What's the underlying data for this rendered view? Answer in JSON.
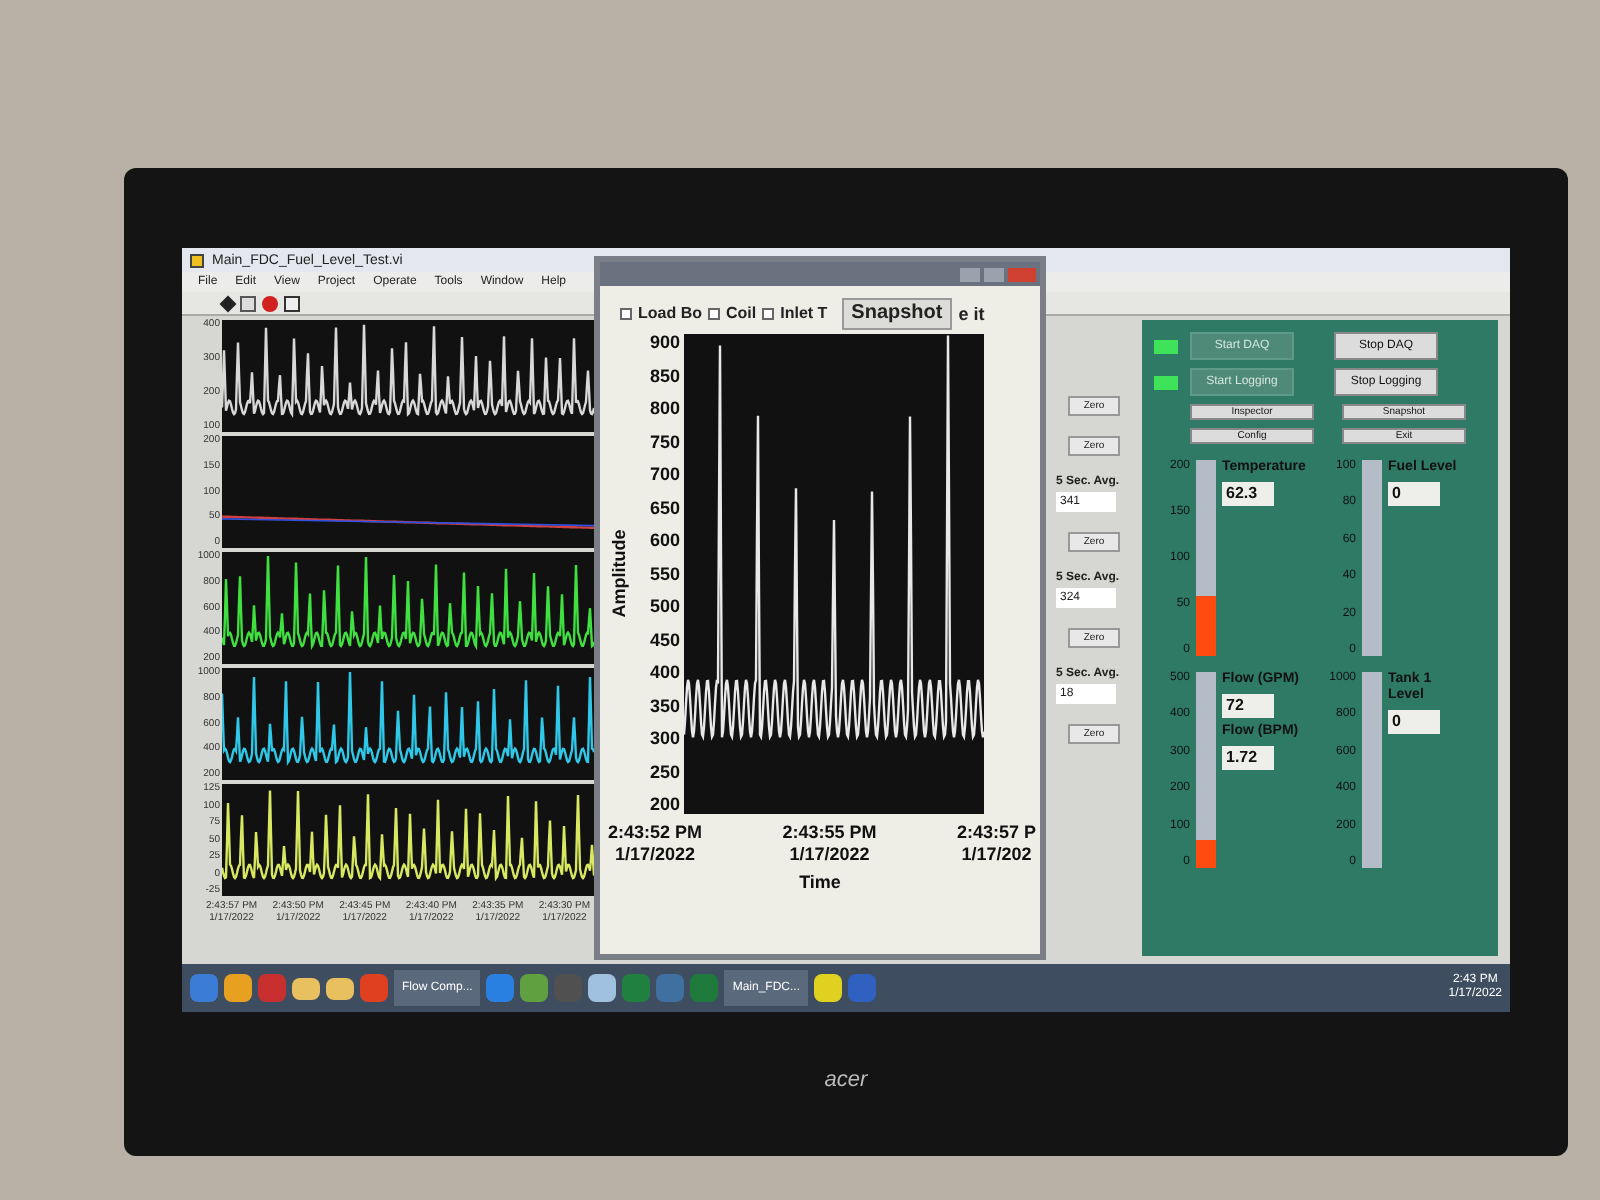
{
  "window": {
    "title": "Main_FDC_Fuel_Level_Test.vi",
    "menu": [
      "File",
      "Edit",
      "View",
      "Project",
      "Operate",
      "Tools",
      "Window",
      "Help"
    ]
  },
  "charts": [
    {
      "kind": "spikes",
      "color": "#d8d8d8",
      "y_ticks": [
        "400",
        "300",
        "200",
        "100"
      ]
    },
    {
      "kind": "flat",
      "color": "#d04040",
      "y_ticks": [
        "200",
        "150",
        "100",
        "50",
        "0"
      ]
    },
    {
      "kind": "spikes",
      "color": "#40e040",
      "y_ticks": [
        "1000",
        "800",
        "600",
        "400",
        "200"
      ]
    },
    {
      "kind": "spikes",
      "color": "#30c8e8",
      "y_ticks": [
        "1000",
        "800",
        "600",
        "400",
        "200"
      ]
    },
    {
      "kind": "spikes",
      "color": "#d8e860",
      "y_ticks": [
        "125",
        "100",
        "75",
        "50",
        "25",
        "0",
        "-25"
      ]
    }
  ],
  "x_labels": [
    {
      "time": "2:43:57 PM",
      "date": "1/17/2022"
    },
    {
      "time": "2:43:50 PM",
      "date": "1/17/2022"
    },
    {
      "time": "2:43:45 PM",
      "date": "1/17/2022"
    },
    {
      "time": "2:43:40 PM",
      "date": "1/17/2022"
    },
    {
      "time": "2:43:35 PM",
      "date": "1/17/2022"
    },
    {
      "time": "2:43:30 PM",
      "date": "1/17/2022"
    }
  ],
  "side_column": [
    {
      "kind": "button",
      "label": "Zero"
    },
    {
      "kind": "button",
      "label": "Zero"
    },
    {
      "kind": "average",
      "label": "5 Sec. Avg.",
      "value": "341"
    },
    {
      "kind": "button",
      "label": "Zero"
    },
    {
      "kind": "average",
      "label": "5 Sec. Avg.",
      "value": "324"
    },
    {
      "kind": "button",
      "label": "Zero"
    },
    {
      "kind": "average",
      "label": "5 Sec. Avg.",
      "value": "18"
    },
    {
      "kind": "button",
      "label": "Zero"
    }
  ],
  "popup": {
    "legend": [
      {
        "label": "Load Bo",
        "checked": false
      },
      {
        "label": "Coil",
        "checked": false
      },
      {
        "label": "Inlet T",
        "checked": false
      }
    ],
    "snapshot_button": "Snapshot",
    "cut_text": "e it",
    "y_ticks": [
      "900",
      "850",
      "800",
      "750",
      "700",
      "650",
      "600",
      "550",
      "500",
      "450",
      "400",
      "350",
      "300",
      "250",
      "200"
    ],
    "ylabel": "Amplitude",
    "x_labels": [
      {
        "time": "2:43:52 PM",
        "date": "1/17/2022"
      },
      {
        "time": "2:43:55 PM",
        "date": "1/17/2022"
      },
      {
        "time": "2:43:57 P",
        "date": "1/17/202"
      }
    ],
    "xlabel": "Time"
  },
  "panel": {
    "rows": [
      {
        "led_on": true,
        "left": {
          "label": "Start DAQ",
          "disabled": true
        },
        "right": {
          "label": "Stop DAQ",
          "disabled": false
        }
      },
      {
        "led_on": true,
        "left": {
          "label": "Start Logging",
          "disabled": true
        },
        "right": {
          "label": "Stop Logging",
          "disabled": false
        }
      }
    ],
    "small_buttons": [
      "Inspector",
      "Snapshot",
      "Config",
      "Exit"
    ],
    "gauges": [
      {
        "ticks": [
          "200",
          "150",
          "100",
          "50",
          "0"
        ],
        "level": 0.31,
        "readouts": [
          {
            "label": "Temperature",
            "value": "62.3"
          }
        ]
      },
      {
        "ticks": [
          "100",
          "80",
          "60",
          "40",
          "20",
          "0"
        ],
        "level": 0,
        "readouts": [
          {
            "label": "Fuel Level",
            "value": "0"
          }
        ]
      },
      {
        "ticks": [
          "500",
          "400",
          "300",
          "200",
          "100",
          "0"
        ],
        "level": 0.14,
        "readouts": [
          {
            "label": "Flow (GPM)",
            "value": "72"
          },
          {
            "label": "Flow (BPM)",
            "value": "1.72"
          }
        ]
      },
      {
        "ticks": [
          "1000",
          "800",
          "600",
          "400",
          "200",
          "0"
        ],
        "level": 0,
        "readouts": [
          {
            "label": "Tank 1 Level",
            "value": "0"
          }
        ]
      }
    ]
  },
  "taskbar": {
    "items": [
      {
        "kind": "icon",
        "color": "#3a7bd5"
      },
      {
        "kind": "icon",
        "color": "#e8a020"
      },
      {
        "kind": "icon",
        "color": "#c83030"
      },
      {
        "kind": "folder"
      },
      {
        "kind": "folder"
      },
      {
        "kind": "icon",
        "color": "#e04020"
      },
      {
        "kind": "button",
        "label": "Flow Comp..."
      },
      {
        "kind": "icon",
        "color": "#2a80e0"
      },
      {
        "kind": "icon",
        "color": "#60a040"
      },
      {
        "kind": "icon",
        "color": "#505050"
      },
      {
        "kind": "icon",
        "color": "#a0c0e0"
      },
      {
        "kind": "icon",
        "color": "#208040"
      },
      {
        "kind": "icon",
        "color": "#4070a0"
      },
      {
        "kind": "icon",
        "color": "#1d7a3a"
      },
      {
        "kind": "button",
        "label": "Main_FDC..."
      },
      {
        "kind": "icon",
        "color": "#e0d020"
      },
      {
        "kind": "icon",
        "color": "#3060c0"
      }
    ],
    "time": "2:43 PM",
    "date": "1/17/2022"
  },
  "monitor": {
    "brand": "acer"
  }
}
